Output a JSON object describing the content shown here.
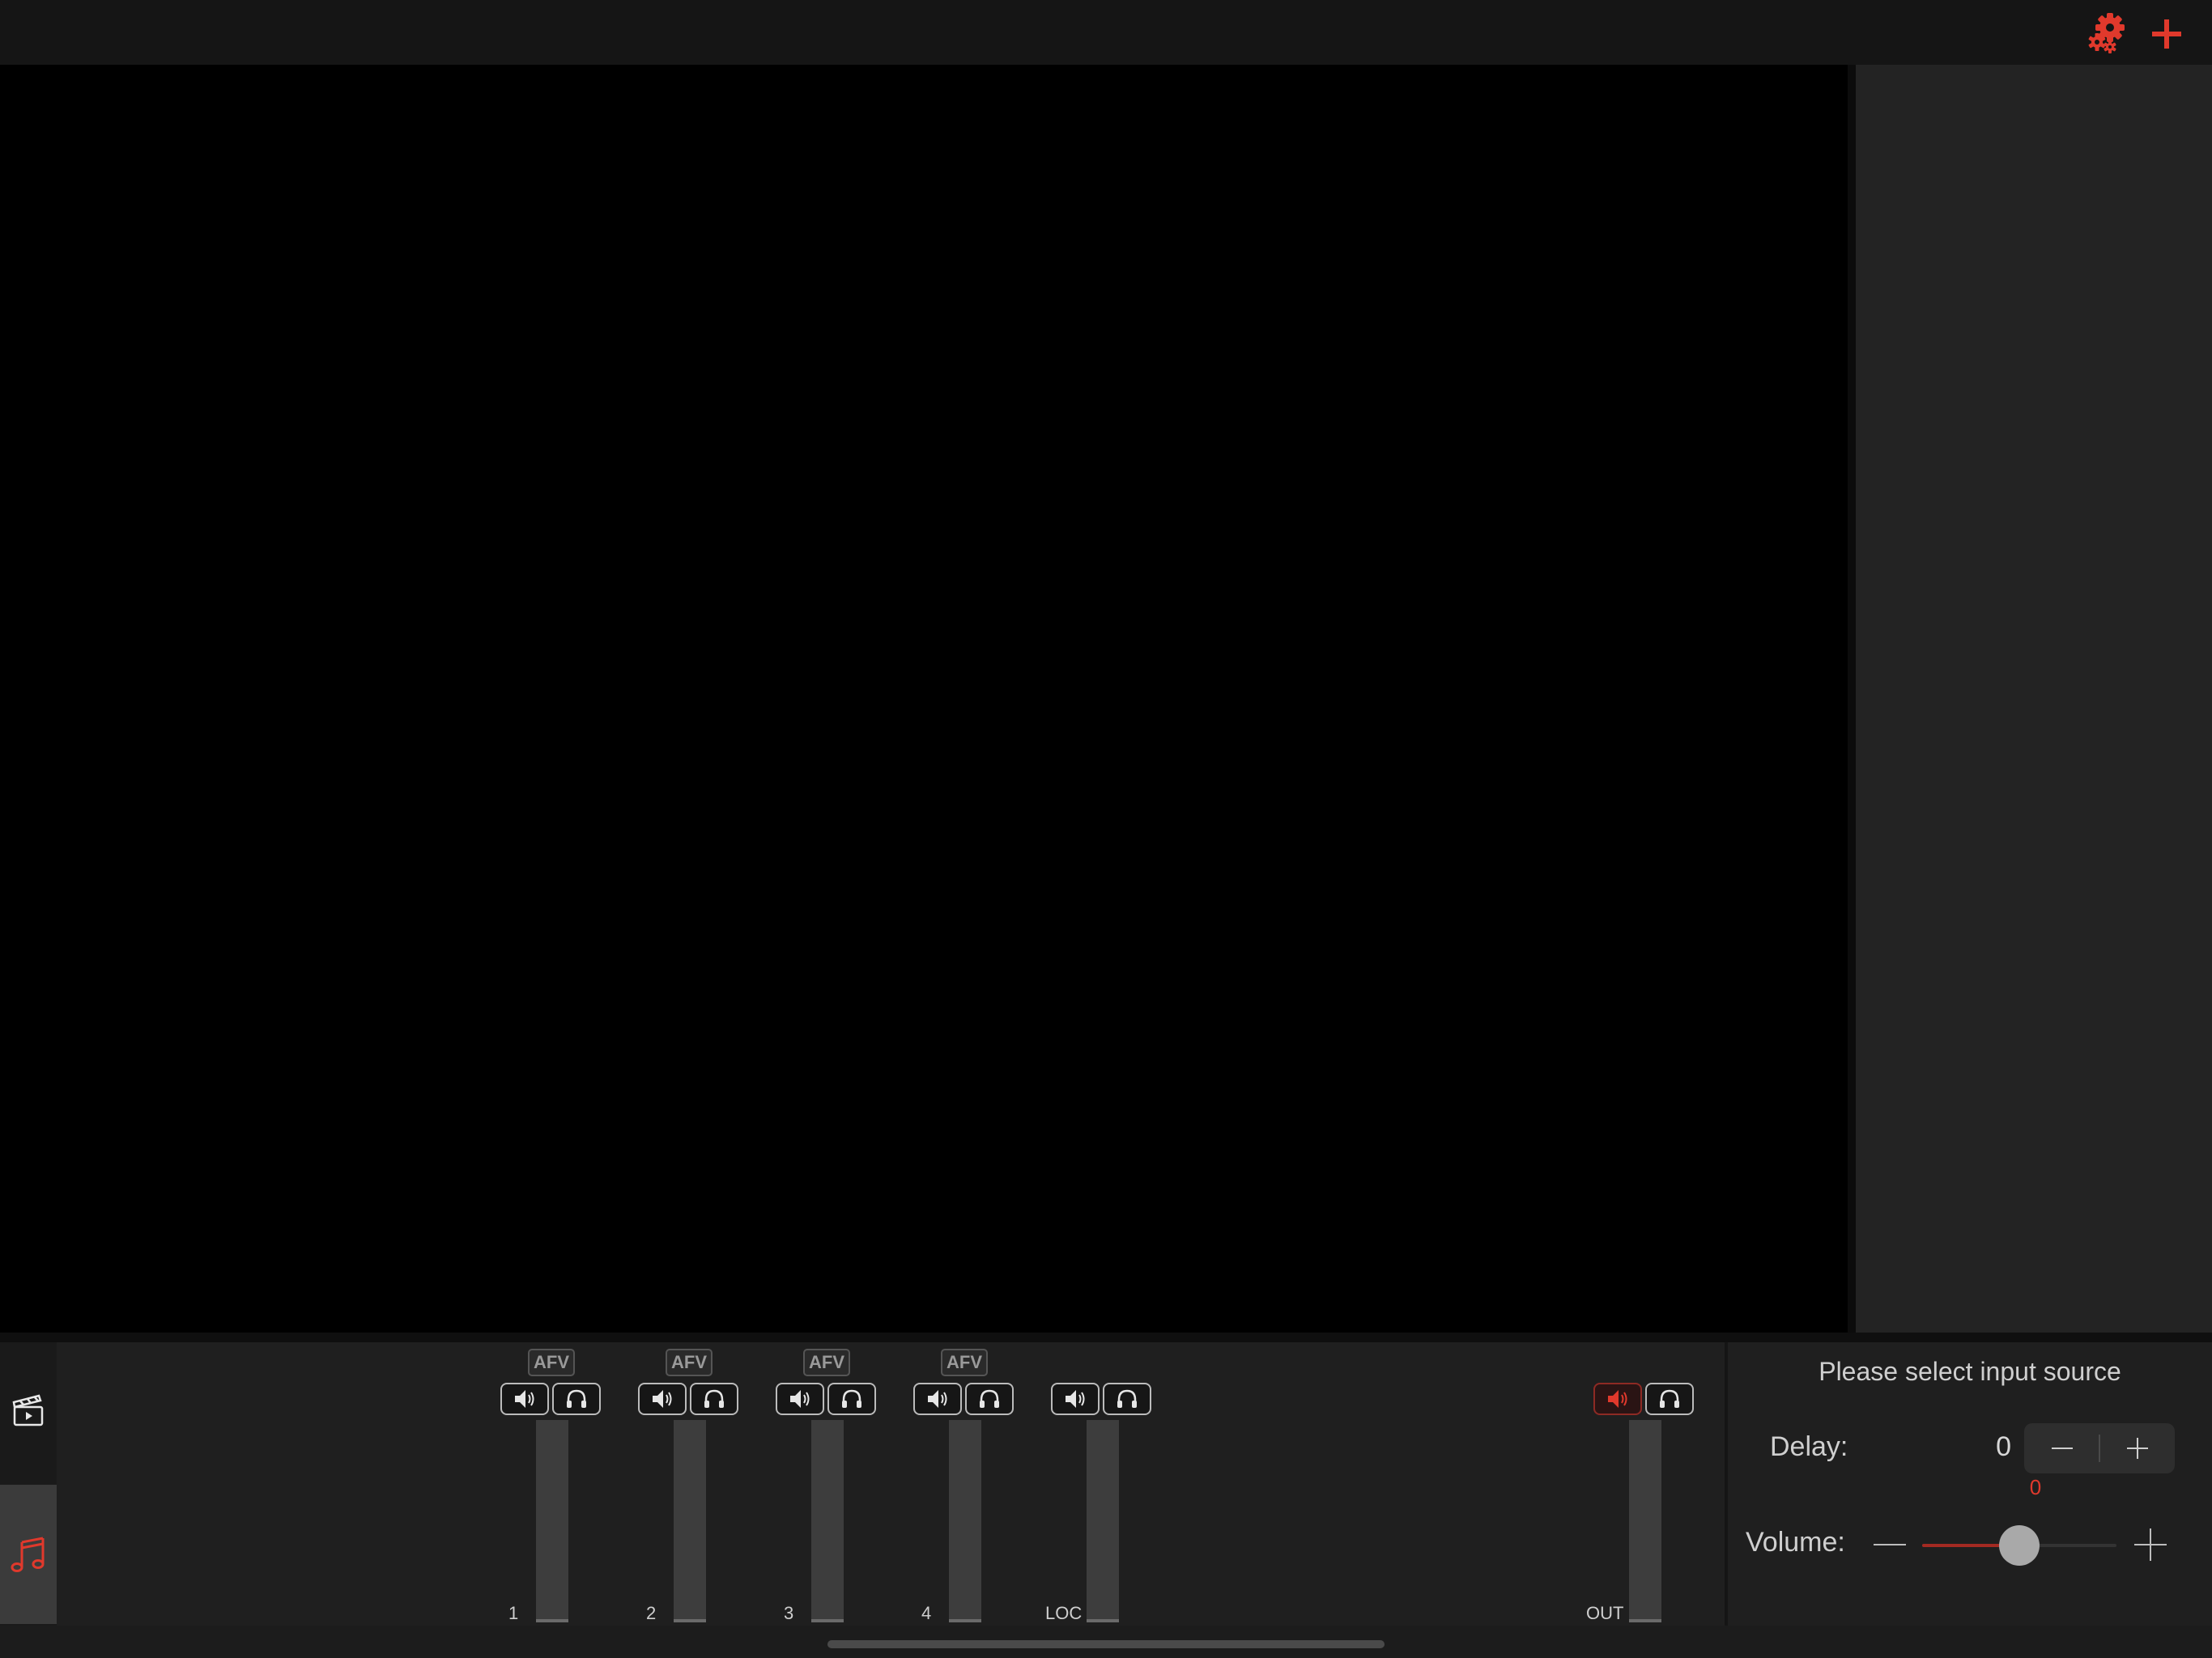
{
  "toolbar": {
    "icons": [
      "gears-icon",
      "plus-icon"
    ],
    "accent": "#e0392c"
  },
  "tabs": [
    {
      "icon": "clapperboard-icon"
    },
    {
      "icon": "music-notes-icon",
      "active": true
    }
  ],
  "channels": [
    {
      "label": "1",
      "afv": "AFV"
    },
    {
      "label": "2",
      "afv": "AFV"
    },
    {
      "label": "3",
      "afv": "AFV"
    },
    {
      "label": "4",
      "afv": "AFV"
    },
    {
      "label": "LOC"
    }
  ],
  "output": {
    "label": "OUT",
    "muted": true
  },
  "settings": {
    "prompt": "Please select input source",
    "delay_label": "Delay:",
    "delay_value": "0",
    "delay_sub_value": "0",
    "volume_label": "Volume:",
    "volume_level": 0.5
  }
}
